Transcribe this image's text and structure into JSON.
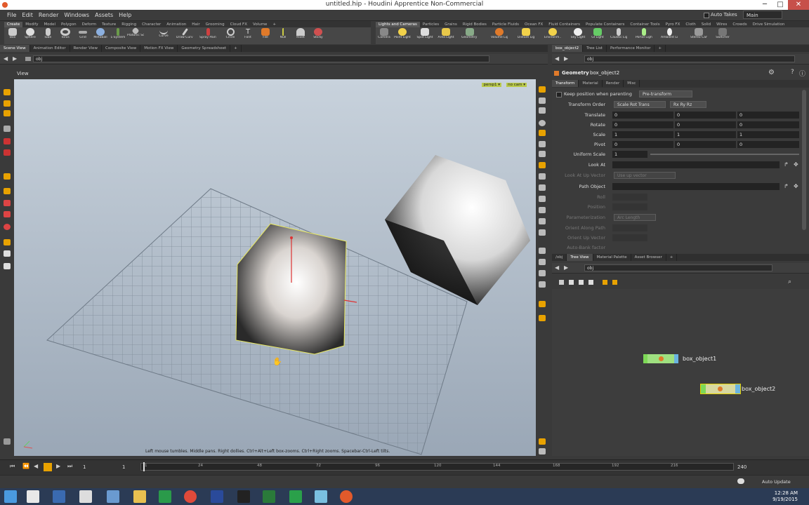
{
  "window": {
    "title": "untitled.hip - Houdini Apprentice Non-Commercial",
    "minimize": "─",
    "maximize": "□",
    "close": "✕"
  },
  "menubar": {
    "items": [
      "File",
      "Edit",
      "Render",
      "Windows",
      "Assets",
      "Help"
    ],
    "auto_takes": "Auto Takes",
    "desktop": "Main"
  },
  "shelf_left": {
    "tabs": [
      "Create",
      "Modify",
      "Model",
      "Polygon",
      "Deform",
      "Texture",
      "Rigging",
      "Character",
      "Animation",
      "Hair",
      "Grooming",
      "Cloud FX",
      "Volume"
    ],
    "tools": [
      "Box",
      "Sphere",
      "Tube",
      "Torus",
      "Grid",
      "Metaball",
      "L-System",
      "Platonic Sol.",
      "Curve",
      "Draw Curve",
      "Spray Paint",
      "Circle",
      "Font",
      "File",
      "Null",
      "Rivet",
      "Sticky"
    ]
  },
  "shelf_right": {
    "tabs": [
      "Lights and Cameras",
      "Particles",
      "Grains",
      "Rigid Bodies",
      "Particle Fluids",
      "Ocean FX",
      "Fluid Containers",
      "Populate Containers",
      "Container Tools",
      "Pyro FX",
      "Cloth",
      "Solid",
      "Wires",
      "Crowds",
      "Drive Simulation"
    ],
    "tools": [
      "Camera",
      "Point Light",
      "Spot Light",
      "Area Light",
      "Geometry L..",
      "Volume Light",
      "Distant Light",
      "Environm..",
      "Sky Light",
      "GI Light",
      "Caustic Light",
      "Portal Light",
      "Ambient Lig..",
      "Stereo Cam..",
      "Switcher"
    ]
  },
  "left_pane": {
    "tabs": [
      "Scene View",
      "Animation Editor",
      "Render View",
      "Composite View",
      "Motion FX View",
      "Geometry Spreadsheet"
    ],
    "path": "obj",
    "view_label": "View",
    "camera_menu": "persp1 ▾",
    "cam_badge": "no cam ▾",
    "hint": "Left mouse tumbles. Middle pans. Right dollies. Ctrl+Alt+Left box-zooms. Ctrl+Right zooms. Spacebar-Ctrl-Left tilts."
  },
  "right_pane": {
    "tabs": [
      "box_object2",
      "Tree List",
      "Performance Monitor"
    ],
    "path": "obj",
    "node_type": "Geometry",
    "node_name": "box_object2",
    "param_tabs": [
      "Transform",
      "Material",
      "Render",
      "Misc"
    ],
    "keep_position": "Keep position when parenting",
    "keep_position_value": "Pre-transform",
    "transform_order_label": "Transform Order",
    "transform_order": "Scale Rot Trans",
    "rotate_order": "Rx Ry Rz",
    "translate": {
      "label": "Translate",
      "values": [
        "0",
        "0",
        "0"
      ]
    },
    "rotate": {
      "label": "Rotate",
      "values": [
        "0",
        "0",
        "0"
      ]
    },
    "scale": {
      "label": "Scale",
      "values": [
        "1",
        "1",
        "1"
      ]
    },
    "pivot": {
      "label": "Pivot",
      "values": [
        "0",
        "0",
        "0"
      ]
    },
    "uniform_scale": {
      "label": "Uniform Scale",
      "value": "1"
    },
    "look_at": "Look At",
    "look_at_up": "Look At Up Vector",
    "look_at_up_value": "Use up vector",
    "path_object": "Path Object",
    "roll": "Roll",
    "position": "Position",
    "parameterization": "Parameterization",
    "parameterization_value": "Arc Length",
    "orient_along_path": "Orient Along Path",
    "orient_up_vector": "Orient Up Vector",
    "auto_bank": "Auto-Bank factor"
  },
  "network": {
    "tabs": [
      "/obj",
      "Tree View",
      "Material Palette",
      "Asset Browser"
    ],
    "path": "obj",
    "nodes": [
      "box_object1",
      "box_object2"
    ]
  },
  "timeline": {
    "frame": "1",
    "start": "1",
    "end": "240",
    "ticks": [
      "1",
      "24",
      "48",
      "72",
      "96",
      "120",
      "144",
      "168",
      "192",
      "216"
    ]
  },
  "statusbar": {
    "auto_update": "Auto Update"
  },
  "taskbar": {
    "time": "12:28 AM",
    "date": "9/19/2015"
  },
  "colors": {
    "accent_yellow": "#e8a200",
    "node_green": "#7ed957",
    "viewport_top": "#c8d2dc",
    "viewport_bottom": "#9aa7b6"
  }
}
